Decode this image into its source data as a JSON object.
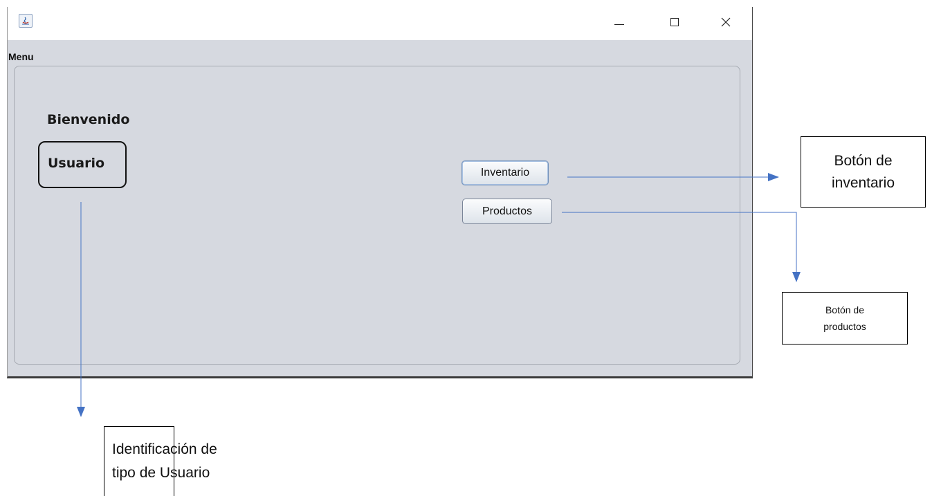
{
  "window": {
    "menu_label": "Menu",
    "controls": {
      "minimize": "minimize-icon",
      "maximize": "maximize-icon",
      "close": "close-icon"
    }
  },
  "main": {
    "welcome": "Bienvenido",
    "user_type": "Usuario",
    "buttons": {
      "inventario": "Inventario",
      "productos": "Productos"
    }
  },
  "annotations": {
    "inventario": [
      "Botón de",
      "inventario"
    ],
    "productos": [
      "Botón de",
      "productos"
    ],
    "usuario": [
      "Identificación de",
      "tipo de Usuario"
    ]
  },
  "colors": {
    "arrow": "#4472c4",
    "window_bg": "#d6d9e0"
  }
}
